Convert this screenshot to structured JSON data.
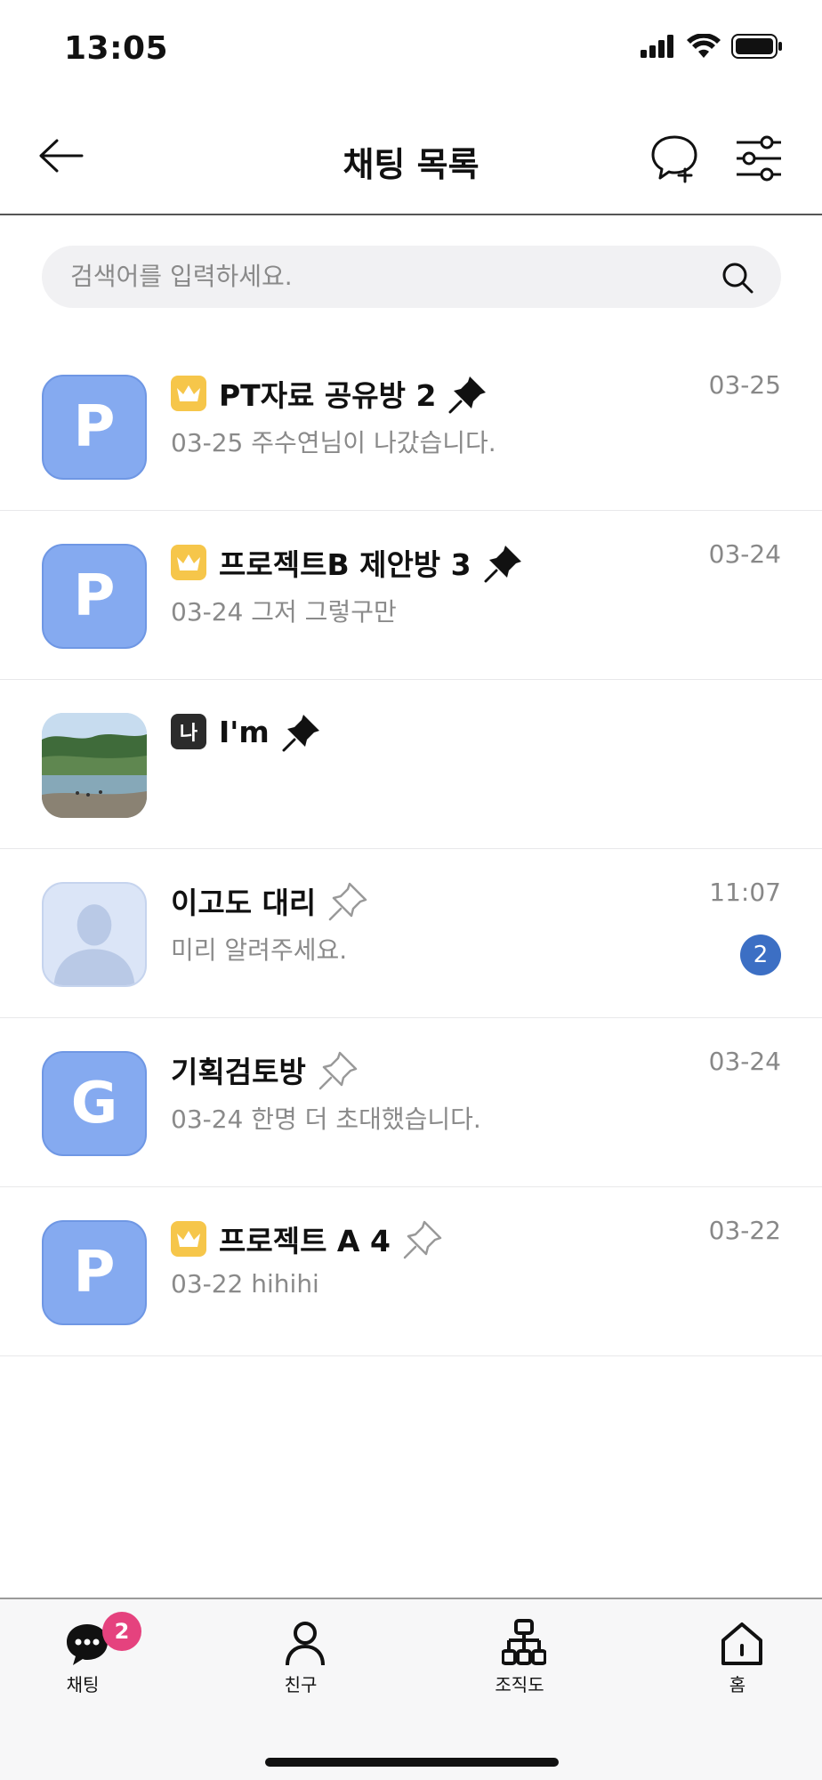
{
  "status_bar": {
    "time": "13:05"
  },
  "header": {
    "title": "채팅 목록"
  },
  "search": {
    "placeholder": "검색어를 입력하세요."
  },
  "chats": [
    {
      "avatar_letter": "P",
      "name": "PT자료 공유방 2",
      "time": "03-25",
      "preview": "03-25 주수연님이 나갔습니다.",
      "badge": "crown",
      "pinned": true
    },
    {
      "avatar_letter": "P",
      "name": "프로젝트B 제안방 3",
      "time": "03-24",
      "preview": "03-24 그저 그렇구만",
      "badge": "crown",
      "pinned": true
    },
    {
      "avatar_letter": "",
      "name": "I'm",
      "time": "",
      "preview": "",
      "badge": "me",
      "badge_text": "나",
      "pinned": true,
      "avatar_type": "photo"
    },
    {
      "avatar_letter": "",
      "name": "이고도 대리",
      "time": "11:07",
      "preview": "미리 알려주세요.",
      "badge": "none",
      "pinned": false,
      "unread": "2",
      "avatar_type": "profile"
    },
    {
      "avatar_letter": "G",
      "name": "기획검토방",
      "time": "03-24",
      "preview": "03-24 한명 더 초대했습니다.",
      "badge": "none",
      "pinned": false
    },
    {
      "avatar_letter": "P",
      "name": "프로젝트 A 4",
      "time": "03-22",
      "preview": "03-22 hihihi",
      "badge": "crown",
      "pinned": false
    }
  ],
  "tab_bar": {
    "chat": {
      "label": "채팅",
      "badge": "2"
    },
    "friends": {
      "label": "친구"
    },
    "org": {
      "label": "조직도"
    },
    "home": {
      "label": "홈"
    }
  },
  "colors": {
    "avatar_blue": "#85aaf0",
    "crown_yellow": "#f6c64a",
    "unread_blue": "#3c6fc4",
    "tab_badge_pink": "#e5427e"
  }
}
